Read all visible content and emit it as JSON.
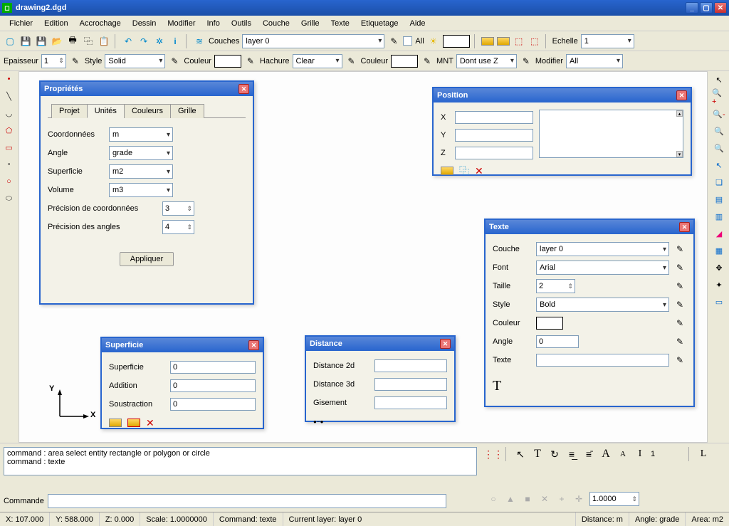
{
  "title": "drawing2.dgd",
  "menu": [
    "Fichier",
    "Edition",
    "Accrochage",
    "Dessin",
    "Modifier",
    "Info",
    "Outils",
    "Couche",
    "Grille",
    "Texte",
    "Etiquetage",
    "Aide"
  ],
  "toolbar1": {
    "couches_label": "Couches",
    "layer": "layer 0",
    "all_label": "All",
    "echelle_label": "Echelle",
    "echelle_value": "1"
  },
  "toolbar2": {
    "epaisseur_label": "Epaisseur",
    "epaisseur_value": "1",
    "style_label": "Style",
    "style_value": "Solid",
    "couleur_label": "Couleur",
    "hachure_label": "Hachure",
    "hachure_value": "Clear",
    "couleur2_label": "Couleur",
    "mnt_label": "MNT",
    "mnt_value": "Dont use Z",
    "modifier_label": "Modifier",
    "modifier_value": "All"
  },
  "dlg_props": {
    "title": "Propriétés",
    "tabs": [
      "Projet",
      "Unités",
      "Couleurs",
      "Grille"
    ],
    "coords_label": "Coordonnées",
    "coords_value": "m",
    "angle_label": "Angle",
    "angle_value": "grade",
    "superf_label": "Superficie",
    "superf_value": "m2",
    "volume_label": "Volume",
    "volume_value": "m3",
    "prec1_label": "Précision de coordonnées",
    "prec1_value": "3",
    "prec2_label": "Précision des angles",
    "prec2_value": "4",
    "apply": "Appliquer"
  },
  "dlg_pos": {
    "title": "Position",
    "x_label": "X",
    "y_label": "Y",
    "z_label": "Z",
    "x": "",
    "y": "",
    "z": ""
  },
  "dlg_text": {
    "title": "Texte",
    "couche_label": "Couche",
    "couche_value": "layer 0",
    "font_label": "Font",
    "font_value": "Arial",
    "taille_label": "Taille",
    "taille_value": "2",
    "style_label": "Style",
    "style_value": "Bold",
    "couleur_label": "Couleur",
    "angle_label": "Angle",
    "angle_value": "0",
    "texte_label": "Texte",
    "texte_value": ""
  },
  "dlg_superf": {
    "title": "Superficie",
    "sup_label": "Superficie",
    "sup_value": "0",
    "add_label": "Addition",
    "add_value": "0",
    "sub_label": "Soustraction",
    "sub_value": "0"
  },
  "dlg_dist": {
    "title": "Distance",
    "d2d_label": "Distance 2d",
    "d2d_value": "",
    "d3d_label": "Distance 3d",
    "d3d_value": "",
    "gis_label": "Gisement",
    "gis_value": ""
  },
  "axis_y": "Y",
  "axis_x": "X",
  "cmd_history": [
    "command : area   select entity rectangle or polygon or circle",
    "command : texte"
  ],
  "commande_label": "Commande",
  "right_tools_value": "1",
  "right_tools2_value": "1.0000",
  "status": {
    "x": "X: 107.000",
    "y": "Y: 588.000",
    "z": "Z: 0.000",
    "scale": "Scale: 1.0000000",
    "cmd": "Command: texte",
    "layer": "Current layer: layer 0",
    "dist": "Distance: m",
    "angle": "Angle: grade",
    "area": "Area: m2"
  }
}
